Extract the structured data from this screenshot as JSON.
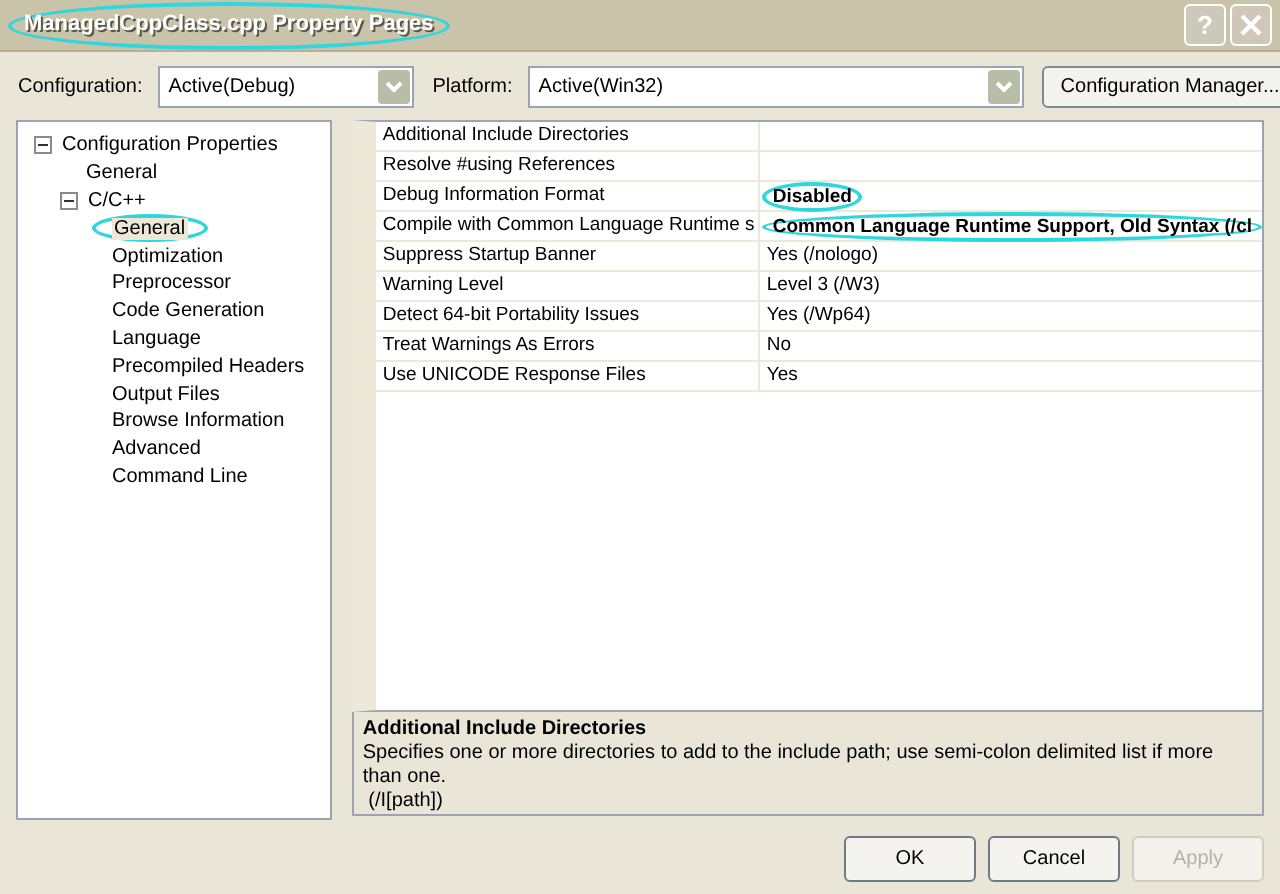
{
  "window": {
    "title": "ManagedCppClass.cpp Property Pages",
    "title_highlighted": true,
    "help_button": "?"
  },
  "toolbar": {
    "configuration": {
      "label": "Configuration:",
      "value": "Active(Debug)"
    },
    "platform": {
      "label": "Platform:",
      "value": "Active(Win32)"
    },
    "manager_button": "Configuration Manager..."
  },
  "tree": [
    {
      "label": "Configuration Properties",
      "expanded": true,
      "selected": false,
      "children": [
        {
          "label": "General",
          "selected": false
        },
        {
          "label": "C/C++",
          "expanded": true,
          "selected": false,
          "children": [
            {
              "label": "General",
              "selected": true,
              "highlighted": true
            },
            {
              "label": "Optimization",
              "selected": false
            },
            {
              "label": "Preprocessor",
              "selected": false
            },
            {
              "label": "Code Generation",
              "selected": false
            },
            {
              "label": "Language",
              "selected": false
            },
            {
              "label": "Precompiled Headers",
              "selected": false
            },
            {
              "label": "Output Files",
              "selected": false
            },
            {
              "label": "Browse Information",
              "selected": false
            },
            {
              "label": "Advanced",
              "selected": false
            },
            {
              "label": "Command Line",
              "selected": false
            }
          ]
        }
      ]
    }
  ],
  "properties": [
    {
      "name": "Additional Include Directories"
    },
    {
      "name": "Resolve #using References"
    },
    {
      "name": "Debug Information Format",
      "value": "Disabled",
      "modified": true,
      "highlighted": true
    },
    {
      "name": "Compile with Common Language Runtime s",
      "value": "Common Language Runtime Support, Old Syntax (/cl",
      "modified": true,
      "highlighted": true
    },
    {
      "name": "Suppress Startup Banner",
      "value": "Yes (/nologo)",
      "modified": false
    },
    {
      "name": "Warning Level",
      "value": "Level 3 (/W3)",
      "modified": false
    },
    {
      "name": "Detect 64-bit Portability Issues",
      "value": "Yes (/Wp64)",
      "modified": false
    },
    {
      "name": "Treat Warnings As Errors",
      "value": "No",
      "modified": false
    },
    {
      "name": "Use UNICODE Response Files",
      "value": "Yes",
      "modified": false
    }
  ],
  "description": {
    "title": "Additional Include Directories",
    "text": "Specifies one or more directories to add to the include path; use semi-colon delimited list if more than one.",
    "switch": "(/I[path])"
  },
  "buttons": [
    {
      "label": "OK",
      "disabled": false
    },
    {
      "label": "Cancel",
      "disabled": false
    },
    {
      "label": "Apply",
      "disabled": true
    }
  ]
}
